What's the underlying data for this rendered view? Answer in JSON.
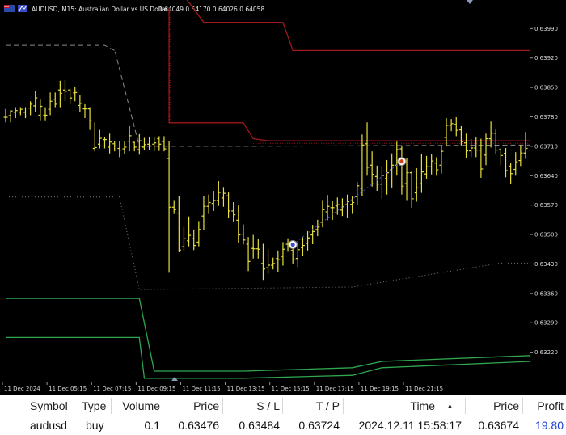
{
  "window": {
    "symbol_title": "AUDUSD, M15:  Australian Dollar vs US Dollar",
    "ohlc": "0.64049 0.64170 0.64026 0.64058"
  },
  "colors": {
    "background": "#000000",
    "candles": "#e8e03a",
    "upper_band": "#a01818",
    "lower_band": "#2fa84f",
    "dashed_level": "#8a8a8a",
    "dotted_level": "#7a7a7a"
  },
  "icons": [
    "flag-icon",
    "chart-type-icon",
    "entry-marker-icon",
    "exit-marker-icon",
    "scroll-marker-icon"
  ],
  "chart_data": {
    "type": "line",
    "title": "",
    "ylim": [
      0.6315,
      0.64058
    ],
    "y_ticks": [
      "0.63990",
      "0.63920",
      "0.63850",
      "0.63780",
      "0.63710",
      "0.63640",
      "0.63570",
      "0.63500",
      "0.63430",
      "0.63360",
      "0.63290",
      "0.63220"
    ],
    "x_ticks": [
      "11 Dec 2024",
      "11 Dec 05:15",
      "11 Dec 07:15",
      "11 Dec 09:15",
      "11 Dec 11:15",
      "11 Dec 13:15",
      "11 Dec 15:15",
      "11 Dec 17:15",
      "11 Dec 19:15",
      "11 Dec 21:15"
    ],
    "candles": [
      {
        "o": 0.63779,
        "h": 0.63799,
        "l": 0.63767,
        "c": 0.63779
      },
      {
        "o": 0.63783,
        "h": 0.63796,
        "l": 0.63767,
        "c": 0.63794
      },
      {
        "o": 0.63791,
        "h": 0.63803,
        "l": 0.63777,
        "c": 0.63795
      },
      {
        "o": 0.63791,
        "h": 0.63803,
        "l": 0.63784,
        "c": 0.63798
      },
      {
        "o": 0.63791,
        "h": 0.63803,
        "l": 0.63777,
        "c": 0.63782
      },
      {
        "o": 0.63801,
        "h": 0.63817,
        "l": 0.63784,
        "c": 0.6381
      },
      {
        "o": 0.63806,
        "h": 0.63842,
        "l": 0.63791,
        "c": 0.63825
      },
      {
        "o": 0.63784,
        "h": 0.63821,
        "l": 0.6377,
        "c": 0.63805
      },
      {
        "o": 0.63784,
        "h": 0.63803,
        "l": 0.6377,
        "c": 0.63784
      },
      {
        "o": 0.63798,
        "h": 0.63838,
        "l": 0.63784,
        "c": 0.63817
      },
      {
        "o": 0.63822,
        "h": 0.63838,
        "l": 0.63803,
        "c": 0.6381
      },
      {
        "o": 0.63844,
        "h": 0.63866,
        "l": 0.63803,
        "c": 0.63836
      },
      {
        "o": 0.63844,
        "h": 0.63868,
        "l": 0.63817,
        "c": 0.63841
      },
      {
        "o": 0.63844,
        "h": 0.63847,
        "l": 0.6381,
        "c": 0.63825
      },
      {
        "o": 0.63837,
        "h": 0.63852,
        "l": 0.63817,
        "c": 0.63838
      },
      {
        "o": 0.63807,
        "h": 0.63831,
        "l": 0.63791,
        "c": 0.63812
      },
      {
        "o": 0.63799,
        "h": 0.6381,
        "l": 0.63777,
        "c": 0.63799
      },
      {
        "o": 0.63799,
        "h": 0.63803,
        "l": 0.63749,
        "c": 0.63772
      },
      {
        "o": 0.63705,
        "h": 0.63767,
        "l": 0.63698,
        "c": 0.63707
      },
      {
        "o": 0.63715,
        "h": 0.63749,
        "l": 0.63705,
        "c": 0.63729
      },
      {
        "o": 0.63726,
        "h": 0.63733,
        "l": 0.63705,
        "c": 0.63726
      },
      {
        "o": 0.63708,
        "h": 0.6374,
        "l": 0.63693,
        "c": 0.6372
      },
      {
        "o": 0.63716,
        "h": 0.63723,
        "l": 0.63698,
        "c": 0.63711
      },
      {
        "o": 0.63705,
        "h": 0.63723,
        "l": 0.63684,
        "c": 0.63701
      },
      {
        "o": 0.63704,
        "h": 0.63723,
        "l": 0.63691,
        "c": 0.63708
      },
      {
        "o": 0.63722,
        "h": 0.63758,
        "l": 0.63698,
        "c": 0.63735
      },
      {
        "o": 0.63719,
        "h": 0.63721,
        "l": 0.63698,
        "c": 0.63708
      },
      {
        "o": 0.63702,
        "h": 0.63739,
        "l": 0.6369,
        "c": 0.63723
      },
      {
        "o": 0.63708,
        "h": 0.6373,
        "l": 0.63701,
        "c": 0.63714
      },
      {
        "o": 0.63715,
        "h": 0.63733,
        "l": 0.63701,
        "c": 0.63711
      },
      {
        "o": 0.63715,
        "h": 0.63733,
        "l": 0.63698,
        "c": 0.63718
      },
      {
        "o": 0.63728,
        "h": 0.63734,
        "l": 0.63699,
        "c": 0.63715
      },
      {
        "o": 0.63721,
        "h": 0.63734,
        "l": 0.63698,
        "c": 0.63704
      },
      {
        "o": 0.63681,
        "h": 0.63723,
        "l": 0.63409,
        "c": 0.63565
      },
      {
        "o": 0.63565,
        "h": 0.63582,
        "l": 0.63549,
        "c": 0.63559
      },
      {
        "o": 0.63551,
        "h": 0.63591,
        "l": 0.63458,
        "c": 0.63463
      },
      {
        "o": 0.63471,
        "h": 0.63518,
        "l": 0.63462,
        "c": 0.6349
      },
      {
        "o": 0.63485,
        "h": 0.63543,
        "l": 0.63472,
        "c": 0.63498
      },
      {
        "o": 0.6349,
        "h": 0.63512,
        "l": 0.63463,
        "c": 0.63474
      },
      {
        "o": 0.63482,
        "h": 0.63532,
        "l": 0.63472,
        "c": 0.63512
      },
      {
        "o": 0.63544,
        "h": 0.63592,
        "l": 0.63511,
        "c": 0.63567
      },
      {
        "o": 0.63567,
        "h": 0.63595,
        "l": 0.63549,
        "c": 0.63576
      },
      {
        "o": 0.63574,
        "h": 0.63604,
        "l": 0.63556,
        "c": 0.63581
      },
      {
        "o": 0.63581,
        "h": 0.63627,
        "l": 0.63568,
        "c": 0.636
      },
      {
        "o": 0.63587,
        "h": 0.63613,
        "l": 0.63566,
        "c": 0.63598
      },
      {
        "o": 0.63592,
        "h": 0.636,
        "l": 0.6354,
        "c": 0.63556
      },
      {
        "o": 0.63556,
        "h": 0.63577,
        "l": 0.63531,
        "c": 0.63547
      },
      {
        "o": 0.63534,
        "h": 0.63569,
        "l": 0.63481,
        "c": 0.63499
      },
      {
        "o": 0.63501,
        "h": 0.63524,
        "l": 0.63476,
        "c": 0.63487
      },
      {
        "o": 0.63477,
        "h": 0.63494,
        "l": 0.63413,
        "c": 0.63436
      },
      {
        "o": 0.63467,
        "h": 0.63499,
        "l": 0.63443,
        "c": 0.63466
      },
      {
        "o": 0.63466,
        "h": 0.6349,
        "l": 0.63443,
        "c": 0.63465
      },
      {
        "o": 0.63431,
        "h": 0.63478,
        "l": 0.63392,
        "c": 0.63418
      },
      {
        "o": 0.63421,
        "h": 0.63464,
        "l": 0.63406,
        "c": 0.63427
      },
      {
        "o": 0.63427,
        "h": 0.63445,
        "l": 0.63417,
        "c": 0.63431
      },
      {
        "o": 0.63443,
        "h": 0.63462,
        "l": 0.6341,
        "c": 0.6344
      },
      {
        "o": 0.63448,
        "h": 0.63482,
        "l": 0.63426,
        "c": 0.63465
      },
      {
        "o": 0.63477,
        "h": 0.63491,
        "l": 0.63459,
        "c": 0.63477
      },
      {
        "o": 0.63462,
        "h": 0.63482,
        "l": 0.63431,
        "c": 0.6344
      },
      {
        "o": 0.63443,
        "h": 0.63482,
        "l": 0.63423,
        "c": 0.63464
      },
      {
        "o": 0.63469,
        "h": 0.63495,
        "l": 0.6345,
        "c": 0.63474
      },
      {
        "o": 0.63479,
        "h": 0.63508,
        "l": 0.63462,
        "c": 0.63492
      },
      {
        "o": 0.63499,
        "h": 0.63523,
        "l": 0.63477,
        "c": 0.63507
      },
      {
        "o": 0.63512,
        "h": 0.63535,
        "l": 0.63496,
        "c": 0.63518
      },
      {
        "o": 0.63529,
        "h": 0.63582,
        "l": 0.63517,
        "c": 0.63559
      },
      {
        "o": 0.63554,
        "h": 0.63594,
        "l": 0.63534,
        "c": 0.63567
      },
      {
        "o": 0.63564,
        "h": 0.63581,
        "l": 0.63535,
        "c": 0.63564
      },
      {
        "o": 0.63568,
        "h": 0.63588,
        "l": 0.63547,
        "c": 0.63571
      },
      {
        "o": 0.63558,
        "h": 0.63586,
        "l": 0.63544,
        "c": 0.63566
      },
      {
        "o": 0.63571,
        "h": 0.63595,
        "l": 0.6354,
        "c": 0.63578
      },
      {
        "o": 0.63572,
        "h": 0.63591,
        "l": 0.63549,
        "c": 0.63576
      },
      {
        "o": 0.6359,
        "h": 0.63625,
        "l": 0.63569,
        "c": 0.63616
      },
      {
        "o": 0.6361,
        "h": 0.63738,
        "l": 0.63591,
        "c": 0.63713
      },
      {
        "o": 0.63716,
        "h": 0.63767,
        "l": 0.6364,
        "c": 0.6366
      },
      {
        "o": 0.63665,
        "h": 0.63698,
        "l": 0.63614,
        "c": 0.63643
      },
      {
        "o": 0.63638,
        "h": 0.63664,
        "l": 0.63604,
        "c": 0.6362
      },
      {
        "o": 0.6362,
        "h": 0.63663,
        "l": 0.63585,
        "c": 0.6364
      },
      {
        "o": 0.63633,
        "h": 0.63677,
        "l": 0.63595,
        "c": 0.63647
      },
      {
        "o": 0.63654,
        "h": 0.63693,
        "l": 0.63612,
        "c": 0.63665
      },
      {
        "o": 0.63665,
        "h": 0.63721,
        "l": 0.6364,
        "c": 0.63702
      },
      {
        "o": 0.63704,
        "h": 0.63711,
        "l": 0.63595,
        "c": 0.63615
      },
      {
        "o": 0.63621,
        "h": 0.63682,
        "l": 0.63582,
        "c": 0.63647
      },
      {
        "o": 0.63647,
        "h": 0.63652,
        "l": 0.63564,
        "c": 0.63585
      },
      {
        "o": 0.63599,
        "h": 0.63658,
        "l": 0.63578,
        "c": 0.63611
      },
      {
        "o": 0.63621,
        "h": 0.63692,
        "l": 0.63599,
        "c": 0.63649
      },
      {
        "o": 0.63644,
        "h": 0.63687,
        "l": 0.63633,
        "c": 0.63661
      },
      {
        "o": 0.63661,
        "h": 0.63692,
        "l": 0.63643,
        "c": 0.63675
      },
      {
        "o": 0.6367,
        "h": 0.63684,
        "l": 0.6364,
        "c": 0.63654
      },
      {
        "o": 0.63665,
        "h": 0.63713,
        "l": 0.63645,
        "c": 0.63698
      },
      {
        "o": 0.63731,
        "h": 0.63777,
        "l": 0.63712,
        "c": 0.6376
      },
      {
        "o": 0.6376,
        "h": 0.63775,
        "l": 0.63746,
        "c": 0.63764
      },
      {
        "o": 0.63762,
        "h": 0.63779,
        "l": 0.63734,
        "c": 0.63748
      },
      {
        "o": 0.63749,
        "h": 0.63758,
        "l": 0.63712,
        "c": 0.63721
      },
      {
        "o": 0.63718,
        "h": 0.6374,
        "l": 0.63683,
        "c": 0.63699
      },
      {
        "o": 0.63699,
        "h": 0.63727,
        "l": 0.63685,
        "c": 0.63706
      },
      {
        "o": 0.63706,
        "h": 0.63732,
        "l": 0.63684,
        "c": 0.63701
      },
      {
        "o": 0.63701,
        "h": 0.63728,
        "l": 0.63635,
        "c": 0.63656
      },
      {
        "o": 0.63689,
        "h": 0.6374,
        "l": 0.63665,
        "c": 0.63728
      },
      {
        "o": 0.63728,
        "h": 0.63769,
        "l": 0.63707,
        "c": 0.63741
      },
      {
        "o": 0.63741,
        "h": 0.63751,
        "l": 0.63691,
        "c": 0.63701
      },
      {
        "o": 0.63702,
        "h": 0.63706,
        "l": 0.63665,
        "c": 0.63688
      },
      {
        "o": 0.63693,
        "h": 0.63706,
        "l": 0.63636,
        "c": 0.63652
      },
      {
        "o": 0.63663,
        "h": 0.63671,
        "l": 0.6362,
        "c": 0.63645
      },
      {
        "o": 0.63655,
        "h": 0.63696,
        "l": 0.6364,
        "c": 0.63673
      },
      {
        "o": 0.63676,
        "h": 0.63713,
        "l": 0.63663,
        "c": 0.63694
      },
      {
        "o": 0.63694,
        "h": 0.63744,
        "l": 0.6368,
        "c": 0.63705
      }
    ],
    "upper_band": [
      [
        0,
        0.64068
      ],
      [
        2,
        0.64068
      ],
      [
        10,
        0.64068
      ],
      [
        20,
        0.64068
      ],
      [
        27,
        0.64068
      ],
      [
        30,
        0.64068
      ],
      [
        36,
        0.64068
      ],
      [
        40,
        0.64005
      ],
      [
        56,
        0.64005
      ],
      [
        58,
        0.63938
      ],
      [
        76,
        0.63938
      ],
      [
        100,
        0.63938
      ],
      [
        106,
        0.63938
      ]
    ],
    "upper_band_lower": [
      [
        33,
        0.6404
      ],
      [
        33,
        0.63766
      ],
      [
        48,
        0.63766
      ],
      [
        50,
        0.63728
      ],
      [
        53,
        0.63723
      ],
      [
        70,
        0.63723
      ],
      [
        100,
        0.63723
      ],
      [
        106,
        0.63723
      ]
    ],
    "dashed_level": [
      [
        0,
        0.6395
      ],
      [
        20,
        0.6395
      ],
      [
        22,
        0.63938
      ],
      [
        22,
        0.6394
      ],
      [
        27,
        0.6371
      ],
      [
        48,
        0.6371
      ],
      [
        106,
        0.63713
      ]
    ],
    "dotted_level": [
      [
        0,
        0.63589
      ],
      [
        20,
        0.63589
      ],
      [
        23,
        0.63589
      ],
      [
        27,
        0.63369
      ],
      [
        48,
        0.63372
      ],
      [
        70,
        0.63375
      ],
      [
        100,
        0.63432
      ],
      [
        106,
        0.63432
      ]
    ],
    "lower_band_top": [
      [
        0,
        0.63348
      ],
      [
        27,
        0.63348
      ],
      [
        30,
        0.63175
      ],
      [
        48,
        0.63175
      ],
      [
        70,
        0.63183
      ],
      [
        76,
        0.63198
      ],
      [
        106,
        0.63212
      ]
    ],
    "lower_band_mid": [
      [
        0,
        0.63255
      ],
      [
        27,
        0.63255
      ],
      [
        28,
        0.63158
      ],
      [
        48,
        0.63158
      ],
      [
        70,
        0.63165
      ],
      [
        76,
        0.63183
      ],
      [
        106,
        0.63198
      ]
    ],
    "trade": {
      "open_price": 0.63476,
      "close_price": 0.63674,
      "open_bar": 58,
      "close_bar": 80
    }
  },
  "positions": {
    "headers": {
      "symbol": "Symbol",
      "type": "Type",
      "volume": "Volume",
      "price": "Price",
      "sl": "S / L",
      "tp": "T / P",
      "time": "Time",
      "sort_arrow": "▲",
      "price2": "Price",
      "profit": "Profit"
    },
    "row": {
      "symbol": "audusd",
      "type": "buy",
      "volume": "0.1",
      "price": "0.63476",
      "sl": "0.63484",
      "tp": "0.63724",
      "time": "2024.12.11 15:58:17",
      "price2": "0.63674",
      "profit": "19.80"
    }
  }
}
